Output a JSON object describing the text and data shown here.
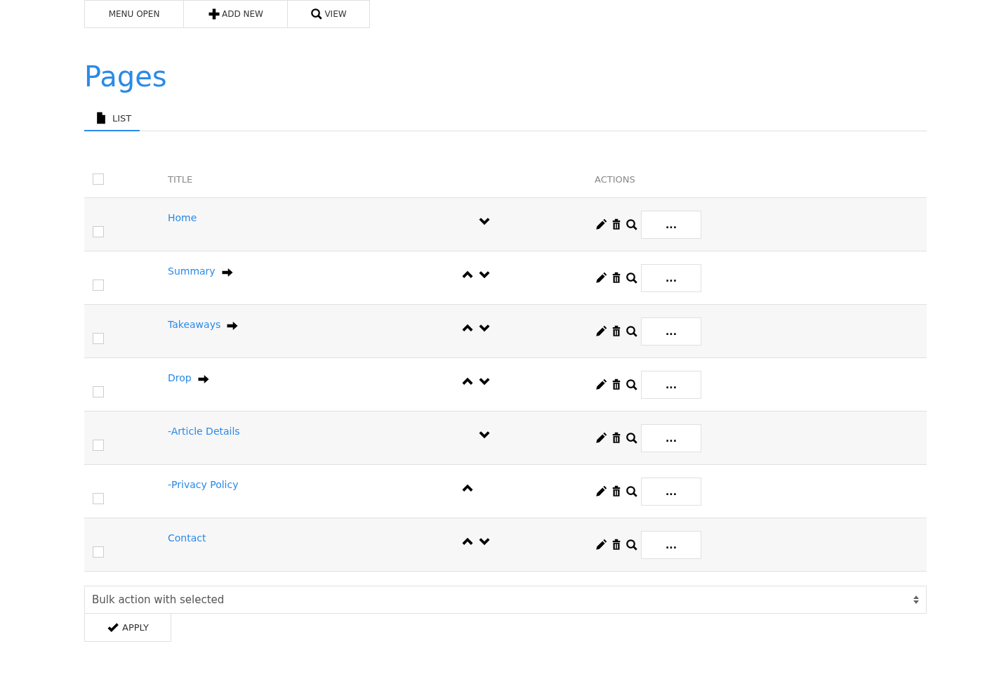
{
  "toolbar": [
    {
      "kind": "menu",
      "label": "MENU OPEN"
    },
    {
      "kind": "add",
      "label": "ADD NEW"
    },
    {
      "kind": "view",
      "label": "VIEW"
    }
  ],
  "heading": "Pages",
  "tabs": [
    {
      "label": "LIST",
      "selected": true
    }
  ],
  "table": {
    "header_checked": false,
    "columns": [
      "TITLE",
      "ACTIONS"
    ],
    "rows": [
      {
        "title": "Home",
        "has_children": false,
        "move_up": false,
        "move_down": true,
        "checked": false,
        "more": "..."
      },
      {
        "title": "Summary",
        "has_children": true,
        "move_up": true,
        "move_down": true,
        "checked": false,
        "more": "..."
      },
      {
        "title": "Takeaways",
        "has_children": true,
        "move_up": true,
        "move_down": true,
        "checked": false,
        "more": "..."
      },
      {
        "title": "Drop",
        "has_children": true,
        "move_up": true,
        "move_down": true,
        "checked": false,
        "more": "..."
      },
      {
        "title": "-Article Details",
        "has_children": false,
        "move_up": false,
        "move_down": true,
        "checked": false,
        "more": "..."
      },
      {
        "title": "-Privacy Policy",
        "has_children": false,
        "move_up": true,
        "move_down": false,
        "checked": false,
        "more": "..."
      },
      {
        "title": "Contact",
        "has_children": false,
        "move_up": true,
        "move_down": true,
        "checked": false,
        "more": "..."
      }
    ]
  },
  "bulk": {
    "value": "Bulk action with selected",
    "apply": "APPLY"
  }
}
